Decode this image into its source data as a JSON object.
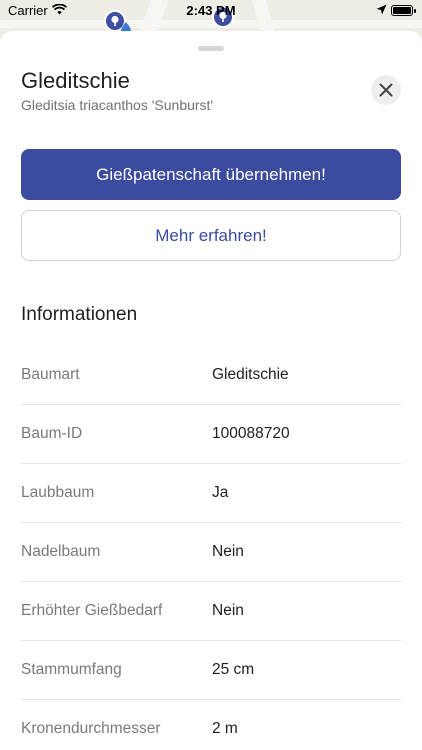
{
  "status_bar": {
    "carrier": "Carrier",
    "time": "2:43 PM"
  },
  "map": {
    "marker_color": "#3d4ea3",
    "marker_icons": [
      "tree-icon",
      "tree-icon",
      "water-drop-icon"
    ]
  },
  "sheet": {
    "title": "Gleditschie",
    "subtitle": "Gleditsia triacanthos 'Sunburst'",
    "close_icon": "close-icon",
    "primary_button": "Gießpatenschaft übernehmen!",
    "secondary_button": "Mehr erfahren!",
    "section_title": "Informationen",
    "info": [
      {
        "label": "Baumart",
        "value": "Gleditschie"
      },
      {
        "label": "Baum-ID",
        "value": "100088720"
      },
      {
        "label": "Laubbaum",
        "value": "Ja"
      },
      {
        "label": "Nadelbaum",
        "value": "Nein"
      },
      {
        "label": "Erhöhter Gießbedarf",
        "value": "Nein"
      },
      {
        "label": "Stammumfang",
        "value": "25 cm"
      },
      {
        "label": "Kronendurchmesser",
        "value": "2 m"
      }
    ]
  },
  "colors": {
    "accent": "#3b4ba0",
    "sheet_background": "#ffffff",
    "label_gray": "#7a7a7a"
  }
}
